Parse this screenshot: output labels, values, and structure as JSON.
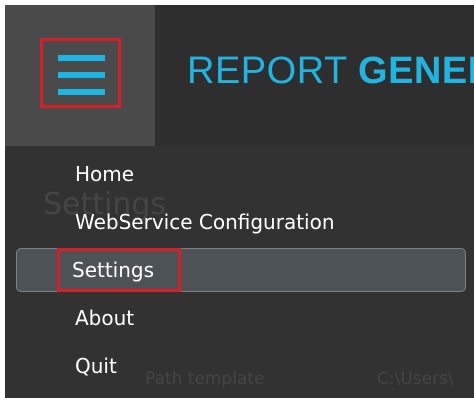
{
  "header": {
    "title_light": "REPORT ",
    "title_bold": "GENER",
    "menu_icon": "hamburger-menu-icon"
  },
  "background": {
    "page_heading": "Settings",
    "field_label": "Path template",
    "field_value": "C:\\Users\\"
  },
  "menu": {
    "items": [
      {
        "label": "Home"
      },
      {
        "label": "WebService Configuration"
      },
      {
        "label": "Settings",
        "selected": true
      },
      {
        "label": "About"
      },
      {
        "label": "Quit"
      }
    ]
  },
  "colors": {
    "accent": "#1fb5e2",
    "annotation": "#d61f26",
    "background": "#323232",
    "selected_item": "#4d5257"
  }
}
